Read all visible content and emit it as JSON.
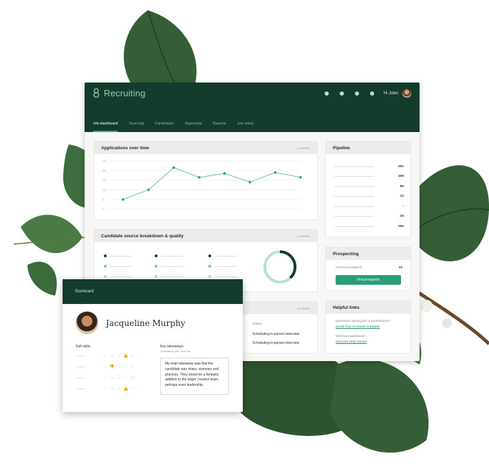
{
  "app": {
    "brand": "Recruiting",
    "greeting": "Hi Jules",
    "tabs": [
      {
        "label": "Job dashboard",
        "active": true
      },
      {
        "label": "Sourcing",
        "active": false
      },
      {
        "label": "Candidates",
        "active": false
      },
      {
        "label": "Approvals",
        "active": false
      },
      {
        "label": "Reports",
        "active": false
      },
      {
        "label": "Job setup",
        "active": false
      }
    ],
    "colors": {
      "header": "#143c2c",
      "accent": "#2a9e76",
      "brand": "#8fd3b3"
    }
  },
  "applications_chart": {
    "title": "Applications over time",
    "range_label": "3 months"
  },
  "chart_data": {
    "type": "line",
    "x": [
      1,
      2,
      3,
      4,
      5,
      6,
      7,
      8
    ],
    "values": [
      5,
      10,
      21.5,
      16.5,
      18.5,
      14,
      19,
      16.5
    ],
    "ytick_labels": [
      "0",
      "5",
      "10",
      "15",
      "20",
      "25"
    ],
    "ylim": [
      0,
      25
    ],
    "grid": true,
    "title": "Applications over time"
  },
  "source_breakdown": {
    "title": "Candidate source breakdown & quality",
    "range_label": "3 months",
    "ring_fraction": 0.38
  },
  "third_panel": {
    "range_label": "3 months",
    "status_header": "Status",
    "rows": [
      "Scheduling in-person interview",
      "Scheduling in-person interview"
    ]
  },
  "pipeline": {
    "title": "Pipeline",
    "values": [
      "201",
      "165",
      "65",
      "12",
      "-",
      "15",
      "160"
    ]
  },
  "prospecting": {
    "title": "Prospecting",
    "label": "Current prospects",
    "count": "12",
    "button": "Find prospects"
  },
  "helpful_links": {
    "title": "Helpful links",
    "q1": "Questions about jobs or permissions?",
    "link1": "Email Your In-House Contacts",
    "q2": "Still have questions?",
    "link2": "Visit Our Help Center"
  },
  "scorecard": {
    "title": "Scorecard",
    "candidate_name": "Jacqueline Murphy",
    "soft_skills_label": "Soft skills",
    "key_takeaways_label": "Key takeaways",
    "key_takeaways_sub": "Conclusions, pros, cons, etc.",
    "takeaway_text": "My main takeaway was that the candidate was sharp, visionary and gracious. They would be a fantastic addition to the larger creative team, perhaps even leadership.",
    "ratings": [
      {
        "selected": 4,
        "icon": "thumbs-up-icon"
      },
      {
        "selected": 2,
        "icon": "thumbs-down-icon"
      },
      {
        "selected": 5,
        "icon": "star-icon"
      },
      {
        "selected": 4,
        "icon": "thumbs-up-icon"
      }
    ]
  }
}
